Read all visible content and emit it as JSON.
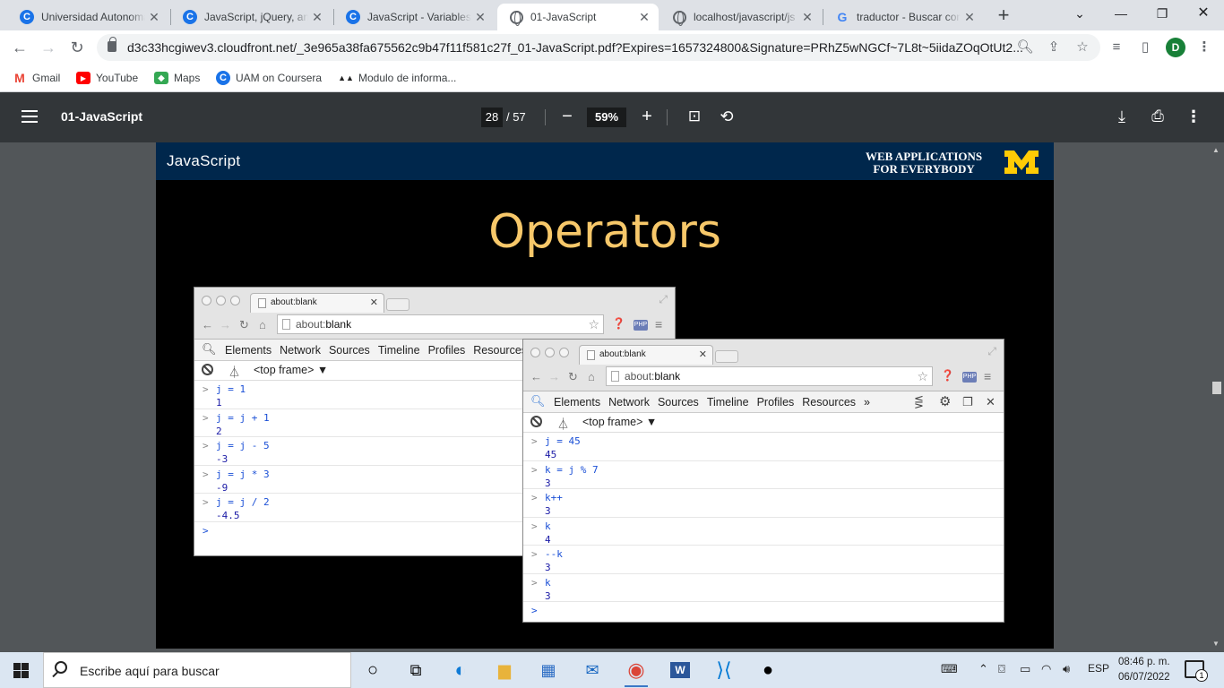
{
  "tabs": [
    {
      "title": "Universidad Autonoma",
      "icon": "c-favicon-icon"
    },
    {
      "title": "JavaScript, jQuery, and",
      "icon": "c-favicon-icon"
    },
    {
      "title": "JavaScript - Variables c",
      "icon": "c-favicon-icon"
    },
    {
      "title": "01-JavaScript",
      "icon": "globe-icon",
      "active": true
    },
    {
      "title": "localhost/javascript/js",
      "icon": "globe-icon"
    },
    {
      "title": "traductor - Buscar con",
      "icon": "google-icon"
    }
  ],
  "tab_close": "✕",
  "address": {
    "url": "d3c33hcgiwev3.cloudfront.net/_3e965a38fa675562c9b47f11f581c27f_01-JavaScript.pdf?Expires=1657324800&Signature=PRhZ5wNGCf~7L8t~5iidaZOqOtUt2..."
  },
  "profile_initial": "D",
  "bookmarks": [
    {
      "label": "Gmail",
      "icon": "gmail-icon"
    },
    {
      "label": "YouTube",
      "icon": "youtube-icon"
    },
    {
      "label": "Maps",
      "icon": "maps-icon"
    },
    {
      "label": "UAM on Coursera",
      "icon": "coursera-icon"
    },
    {
      "label": "Modulo de informa...",
      "icon": "uam-icon"
    }
  ],
  "pdf": {
    "title": "01-JavaScript",
    "page": "28",
    "total": "/ 57",
    "zoom": "59%"
  },
  "slide": {
    "section": "JavaScript",
    "brand_line1": "WEB APPLICATIONS",
    "brand_line2": "FOR EVERYBODY",
    "title": "Operators"
  },
  "mini_browser": {
    "tab_title": "about:blank",
    "url_prefix": "about:",
    "url_main": "blank",
    "devtools_tabs": [
      "Elements",
      "Network",
      "Sources",
      "Timeline",
      "Profiles",
      "Resources"
    ],
    "overflow": "»",
    "frame": "<top frame> ▼"
  },
  "console_left": [
    {
      "input": "j = 1",
      "output": "1"
    },
    {
      "input": "j = j + 1",
      "output": "2"
    },
    {
      "input": "j = j - 5",
      "output": "-3"
    },
    {
      "input": "j = j * 3",
      "output": "-9"
    },
    {
      "input": "j = j / 2",
      "output": "-4.5"
    }
  ],
  "console_right": [
    {
      "input": "j = 45",
      "output": "45"
    },
    {
      "input": "k = j % 7",
      "output": "3"
    },
    {
      "input": "k++",
      "output": "3"
    },
    {
      "input": "k",
      "output": "4"
    },
    {
      "input": "--k",
      "output": "3"
    },
    {
      "input": "k",
      "output": "3"
    }
  ],
  "taskbar": {
    "search_placeholder": "Escribe aquí para buscar",
    "lang": "ESP",
    "time": "08:46 p. m.",
    "date": "06/07/2022",
    "notif_count": "1"
  }
}
